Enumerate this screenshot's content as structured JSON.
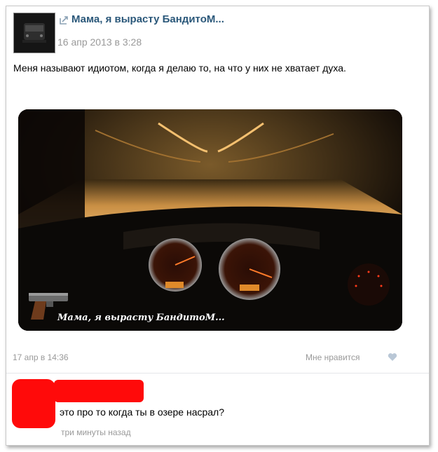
{
  "post": {
    "title": "Мама, я вырасту БандитоМ...",
    "date": "16 апр 2013 в 3:28",
    "text": "Меня называют идиотом, когда я делаю то, на что у них не хватает духа.",
    "photo_caption": "Мама, я вырасту БандитоМ...",
    "footer_date": "17 апр в 14:36",
    "like_label": "Мне нравится"
  },
  "comment": {
    "text": "это про то когда ты в озере насрал?",
    "time": "три минуты назад"
  },
  "colors": {
    "link": "#2b587a",
    "muted": "#999999",
    "redaction": "#ff0a0a"
  },
  "icons": {
    "repost": "repost-arrow-icon",
    "like": "heart-icon",
    "caption_gun": "pistol-icon"
  }
}
